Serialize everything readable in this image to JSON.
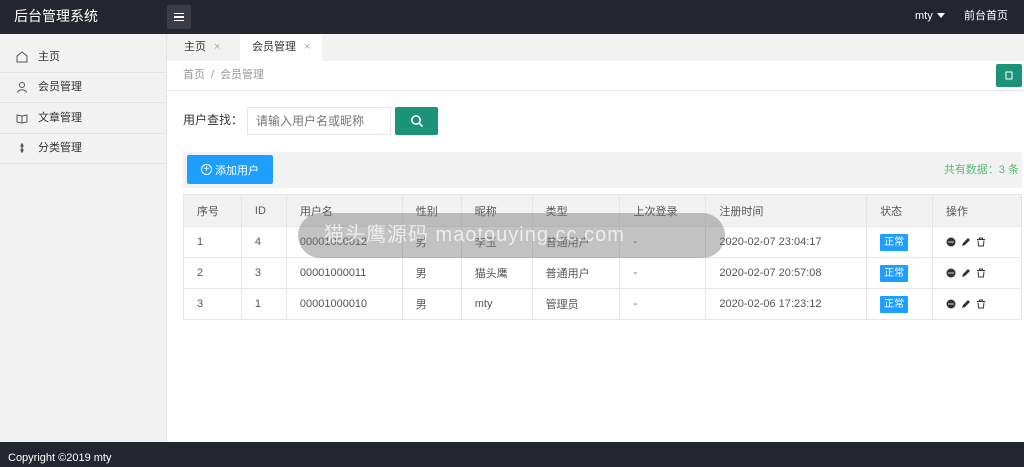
{
  "header": {
    "logo": "后台管理系统",
    "user": "mty",
    "front_link": "前台首页"
  },
  "sidebar": {
    "items": [
      {
        "label": "主页",
        "icon": "home-icon"
      },
      {
        "label": "会员管理",
        "icon": "user-icon"
      },
      {
        "label": "文章管理",
        "icon": "book-icon"
      },
      {
        "label": "分类管理",
        "icon": "tag-icon"
      }
    ]
  },
  "tabs": [
    {
      "label": "主页",
      "close": "×"
    },
    {
      "label": "会员管理",
      "close": "×"
    }
  ],
  "breadcrumb": {
    "home": "首页",
    "sep": "/",
    "current": "会员管理"
  },
  "search": {
    "label": "用户查找：",
    "placeholder": "请输入用户名或昵称"
  },
  "toolbar": {
    "add_label": "添加用户",
    "add_icon": "⊕",
    "total_text": "共有数据：3 条"
  },
  "table": {
    "headers": [
      "序号",
      "ID",
      "用户名",
      "性别",
      "昵称",
      "类型",
      "上次登录",
      "注册时间",
      "状态",
      "操作"
    ],
    "rows": [
      {
        "no": "1",
        "id": "4",
        "username": "00001000012",
        "gender": "男",
        "nickname": "李玉",
        "type": "普通用户",
        "last_login": "-",
        "registered": "2020-02-07 23:04:17",
        "status": "正常"
      },
      {
        "no": "2",
        "id": "3",
        "username": "00001000011",
        "gender": "男",
        "nickname": "猫头鹰",
        "type": "普通用户",
        "last_login": "-",
        "registered": "2020-02-07 20:57:08",
        "status": "正常"
      },
      {
        "no": "3",
        "id": "1",
        "username": "00001000010",
        "gender": "男",
        "nickname": "mty",
        "type": "管理员",
        "last_login": "-",
        "registered": "2020-02-06 17:23:12",
        "status": "正常"
      }
    ]
  },
  "watermark": "猫头鹰源码 maotouying.cc.com",
  "footer": {
    "copyright": "Copyright ©2019 mty"
  },
  "colors": {
    "header_bg": "#23262e",
    "primary_green": "#1a9378",
    "primary_blue": "#1e9fff",
    "total_green": "#5fb878"
  }
}
